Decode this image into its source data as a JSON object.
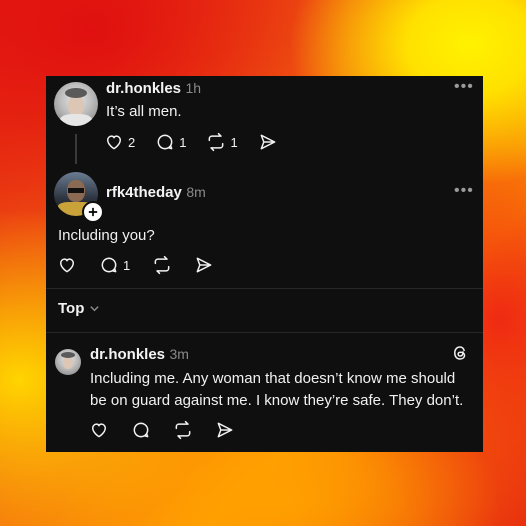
{
  "thread": {
    "parent": {
      "username": "dr.honkles",
      "time": "1h",
      "text": "It’s all men.",
      "like_count": "2",
      "reply_count": "1",
      "repost_count": "1"
    },
    "reply": {
      "username": "rfk4theday",
      "time": "8m",
      "text": "Including you?",
      "reply_count": "1"
    }
  },
  "sort": {
    "label": "Top"
  },
  "comment": {
    "username": "dr.honkles",
    "time": "3m",
    "text_line1": "Including me. Any woman that doesn’t know me should",
    "text_line2": "be on guard against me. I know they’re safe. They don’t."
  },
  "icons": {
    "like": "heart-icon",
    "reply": "comment-icon",
    "repost": "repost-icon",
    "share": "send-icon",
    "follow": "plus-icon",
    "threads": "threads-logo-icon",
    "more": "more-icon"
  }
}
